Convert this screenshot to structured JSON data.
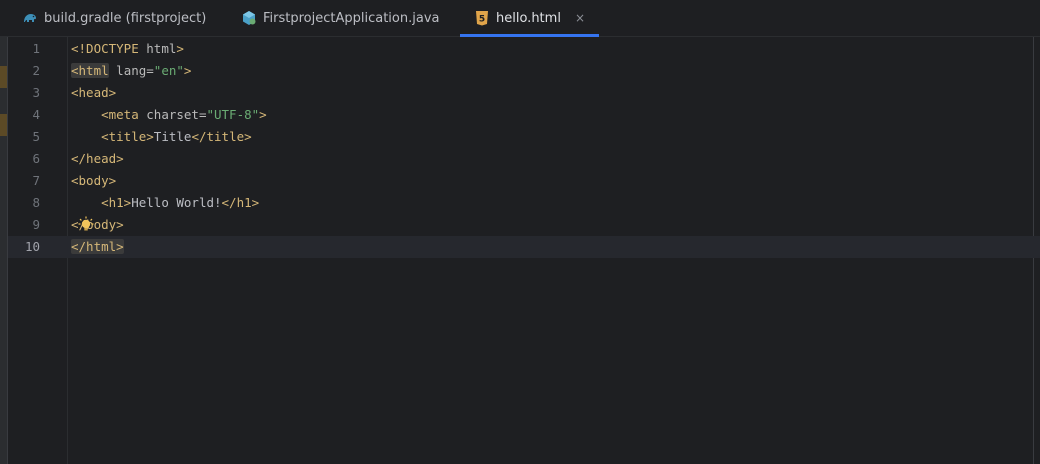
{
  "tabs": [
    {
      "label": "build.gradle (firstproject)",
      "icon": "gradle-elephant-icon",
      "active": false
    },
    {
      "label": "FirstprojectApplication.java",
      "icon": "java-class-icon",
      "active": false
    },
    {
      "label": "hello.html",
      "icon": "html5-icon",
      "active": true
    }
  ],
  "tab_close_glyph": "×",
  "editor": {
    "current_line": 10,
    "line_numbers": [
      "1",
      "2",
      "3",
      "4",
      "5",
      "6",
      "7",
      "8",
      "9",
      "10"
    ],
    "lines": [
      {
        "indent": "",
        "parts": [
          {
            "cls": "t-doc",
            "text": "<!DOCTYPE "
          },
          {
            "cls": "t-attr",
            "text": "html"
          },
          {
            "cls": "t-doc",
            "text": ">"
          }
        ]
      },
      {
        "indent": "",
        "parts": [
          {
            "cls": "t-tag hl-box",
            "text": "<html"
          },
          {
            "cls": "t-attr",
            "text": " lang="
          },
          {
            "cls": "t-val",
            "text": "\"en\""
          },
          {
            "cls": "t-tag",
            "text": ">"
          }
        ]
      },
      {
        "indent": "",
        "parts": [
          {
            "cls": "t-tag",
            "text": "<head>"
          }
        ]
      },
      {
        "indent": "    ",
        "parts": [
          {
            "cls": "t-tag",
            "text": "<meta"
          },
          {
            "cls": "t-attr",
            "text": " charset="
          },
          {
            "cls": "t-val",
            "text": "\"UTF-8\""
          },
          {
            "cls": "t-tag",
            "text": ">"
          }
        ]
      },
      {
        "indent": "    ",
        "parts": [
          {
            "cls": "t-tag",
            "text": "<title>"
          },
          {
            "cls": "t-text",
            "text": "Title"
          },
          {
            "cls": "t-tag",
            "text": "</title>"
          }
        ]
      },
      {
        "indent": "",
        "parts": [
          {
            "cls": "t-tag",
            "text": "</head>"
          }
        ]
      },
      {
        "indent": "",
        "parts": [
          {
            "cls": "t-tag",
            "text": "<body>"
          }
        ]
      },
      {
        "indent": "    ",
        "parts": [
          {
            "cls": "t-tag",
            "text": "<h1>"
          },
          {
            "cls": "t-text",
            "text": "Hello World!"
          },
          {
            "cls": "t-tag",
            "text": "</h1>"
          }
        ]
      },
      {
        "indent": "",
        "parts": [
          {
            "cls": "t-tag",
            "text": "</body>"
          }
        ]
      },
      {
        "indent": "",
        "parts": [
          {
            "cls": "t-tag hl-box",
            "text": "</html>"
          }
        ]
      }
    ]
  },
  "colors": {
    "accent": "#3574f0",
    "tag": "#d5b778",
    "string": "#6aab73",
    "background": "#1e1f22",
    "bulb": "#f2c55c"
  }
}
